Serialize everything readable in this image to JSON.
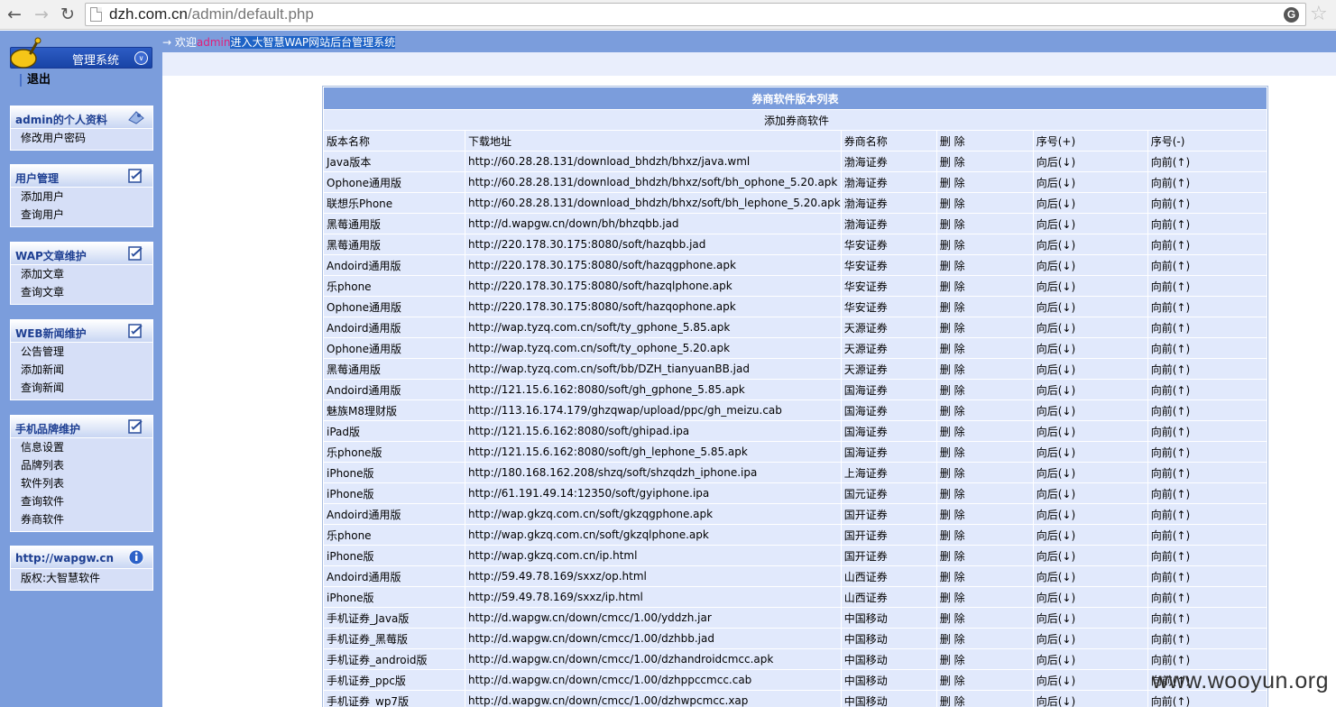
{
  "browser": {
    "url_host": "dzh.com.cn",
    "url_path": "/admin/default.php"
  },
  "header": {
    "arrow": "→ 欢迎",
    "user": "admin",
    "rest": "进入大智慧WAP网站后台管理系统"
  },
  "sidebar": {
    "title": "管理系统",
    "logout": "退出",
    "panels": [
      {
        "title": "admin的个人资料",
        "items": [
          "修改用户密码"
        ]
      },
      {
        "title": "用户管理",
        "items": [
          "添加用户",
          "查询用户"
        ]
      },
      {
        "title": "WAP文章维护",
        "items": [
          "添加文章",
          "查询文章"
        ]
      },
      {
        "title": "WEB新闻维护",
        "items": [
          "公告管理",
          "添加新闻",
          "查询新闻"
        ]
      },
      {
        "title": "手机品牌维护",
        "items": [
          "信息设置",
          "品牌列表",
          "软件列表",
          "查询软件",
          "券商软件"
        ]
      },
      {
        "title": "http://wapgw.cn",
        "items": [
          "版权:大智慧软件"
        ]
      }
    ]
  },
  "table": {
    "caption": "券商软件版本列表",
    "add_link": "添加券商软件",
    "headers": [
      "版本名称",
      "下载地址",
      "券商名称",
      "删 除",
      "序号(+)",
      "序号(-)"
    ],
    "delete_label": "删 除",
    "down_label": "向后(↓)",
    "up_label": "向前(↑)",
    "rows": [
      [
        "Java版本",
        "http://60.28.28.131/download_bhdzh/bhxz/java.wml",
        "渤海证券"
      ],
      [
        "Ophone通用版",
        "http://60.28.28.131/download_bhdzh/bhxz/soft/bh_ophone_5.20.apk",
        "渤海证券"
      ],
      [
        "联想乐Phone",
        "http://60.28.28.131/download_bhdzh/bhxz/soft/bh_lephone_5.20.apk",
        "渤海证券"
      ],
      [
        "黑莓通用版",
        "http://d.wapgw.cn/down/bh/bhzqbb.jad",
        "渤海证券"
      ],
      [
        "黑莓通用版",
        "http://220.178.30.175:8080/soft/hazqbb.jad",
        "华安证券"
      ],
      [
        "Andoird通用版",
        "http://220.178.30.175:8080/soft/hazqgphone.apk",
        "华安证券"
      ],
      [
        "乐phone",
        "http://220.178.30.175:8080/soft/hazqlphone.apk",
        "华安证券"
      ],
      [
        "Ophone通用版",
        "http://220.178.30.175:8080/soft/hazqophone.apk",
        "华安证券"
      ],
      [
        "Andoird通用版",
        "http://wap.tyzq.com.cn/soft/ty_gphone_5.85.apk",
        "天源证券"
      ],
      [
        "Ophone通用版",
        "http://wap.tyzq.com.cn/soft/ty_ophone_5.20.apk",
        "天源证券"
      ],
      [
        "黑莓通用版",
        "http://wap.tyzq.com.cn/soft/bb/DZH_tianyuanBB.jad",
        "天源证券"
      ],
      [
        "Andoird通用版",
        "http://121.15.6.162:8080/soft/gh_gphone_5.85.apk",
        "国海证券"
      ],
      [
        "魅族M8理财版",
        "http://113.16.174.179/ghzqwap/upload/ppc/gh_meizu.cab",
        "国海证券"
      ],
      [
        "iPad版",
        "http://121.15.6.162:8080/soft/ghipad.ipa",
        "国海证券"
      ],
      [
        "乐phone版",
        "http://121.15.6.162:8080/soft/gh_lephone_5.85.apk",
        "国海证券"
      ],
      [
        "iPhone版",
        "http://180.168.162.208/shzq/soft/shzqdzh_iphone.ipa",
        "上海证券"
      ],
      [
        "iPhone版",
        "http://61.191.49.14:12350/soft/gyiphone.ipa",
        "国元证券"
      ],
      [
        "Andoird通用版",
        "http://wap.gkzq.com.cn/soft/gkzqgphone.apk",
        "国开证券"
      ],
      [
        "乐phone",
        "http://wap.gkzq.com.cn/soft/gkzqlphone.apk",
        "国开证券"
      ],
      [
        "iPhone版",
        "http://wap.gkzq.com.cn/ip.html",
        "国开证券"
      ],
      [
        "Andoird通用版",
        "http://59.49.78.169/sxxz/op.html",
        "山西证券"
      ],
      [
        "iPhone版",
        "http://59.49.78.169/sxxz/ip.html",
        "山西证券"
      ],
      [
        "手机证券_Java版",
        "http://d.wapgw.cn/down/cmcc/1.00/yddzh.jar",
        "中国移动"
      ],
      [
        "手机证券_黑莓版",
        "http://d.wapgw.cn/down/cmcc/1.00/dzhbb.jad",
        "中国移动"
      ],
      [
        "手机证券_android版",
        "http://d.wapgw.cn/down/cmcc/1.00/dzhandroidcmcc.apk",
        "中国移动"
      ],
      [
        "手机证券_ppc版",
        "http://d.wapgw.cn/down/cmcc/1.00/dzhppccmcc.cab",
        "中国移动"
      ],
      [
        "手机证券_wp7版",
        "http://d.wapgw.cn/down/cmcc/1.00/dzhwpcmcc.xap",
        "中国移动"
      ]
    ]
  },
  "watermark": "www.wooyun.org"
}
